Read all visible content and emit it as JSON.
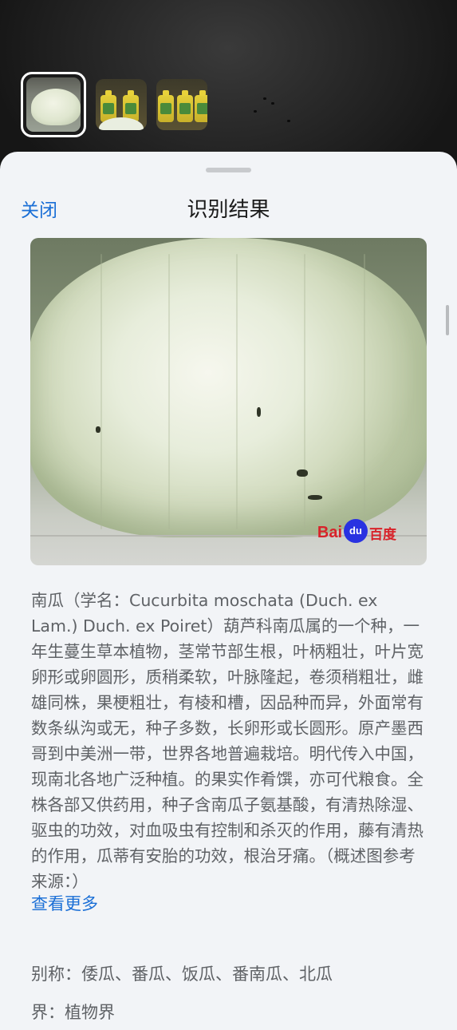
{
  "thumbnails": [
    {
      "name": "pumpkin",
      "selected": true
    },
    {
      "name": "bottles-1",
      "selected": false
    },
    {
      "name": "bottles-2",
      "selected": false
    }
  ],
  "sheet": {
    "close_label": "关闭",
    "title": "识别结果"
  },
  "result": {
    "image_watermark_bai": "Bai",
    "image_watermark_du": "du",
    "image_watermark_cn": "百度",
    "description": "南瓜（学名：Cucurbita moschata (Duch. ex Lam.) Duch. ex Poiret）葫芦科南瓜属的一个种，一年生蔓生草本植物，茎常节部生根，叶柄粗壮，叶片宽卵形或卵圆形，质稍柔软，叶脉隆起，卷须稍粗壮，雌雄同株，果梗粗壮，有棱和槽，因品种而异，外面常有数条纵沟或无，种子多数，长卵形或长圆形。原产墨西哥到中美洲一带，世界各地普遍栽培。明代传入中国，现南北各地广泛种植。的果实作肴馔，亦可代粮食。全株各部又供药用，种子含南瓜子氨基酸，有清热除湿、驱虫的功效，对血吸虫有控制和杀灭的作用，藤有清热的作用，瓜蒂有安胎的功效，根治牙痛。（概述图参考来源：）",
    "more_label": "查看更多",
    "alias_label": "别称：",
    "alias_value": "倭瓜、番瓜、饭瓜、番南瓜、北瓜",
    "kingdom_label": "界：",
    "kingdom_value": "植物界"
  },
  "colors": {
    "accent": "#1b6fd6",
    "sheet_bg": "#f2f4f7",
    "text_secondary": "#5f6266"
  },
  "icons": [
    "baidu-logo"
  ]
}
